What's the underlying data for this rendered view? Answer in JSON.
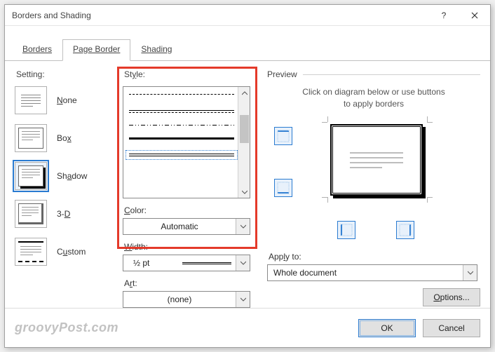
{
  "titlebar": {
    "title": "Borders and Shading"
  },
  "tabs": {
    "borders": "Borders",
    "page_border": "Page Border",
    "shading": "Shading"
  },
  "setting": {
    "label": "Setting:",
    "none": "None",
    "box": "Box",
    "shadow": "Shadow",
    "threeD": "3-D",
    "custom": "Custom"
  },
  "style": {
    "label": "Style:"
  },
  "color": {
    "label": "Color:",
    "value": "Automatic"
  },
  "width": {
    "label": "Width:",
    "value": "½ pt"
  },
  "art": {
    "label": "Art:",
    "value": "(none)"
  },
  "preview": {
    "label": "Preview",
    "hint_l1": "Click on diagram below or use buttons",
    "hint_l2": "to apply borders"
  },
  "apply": {
    "label": "Apply to:",
    "value": "Whole document"
  },
  "buttons": {
    "options": "Options...",
    "ok": "OK",
    "cancel": "Cancel"
  },
  "watermark": "groovyPost.com"
}
